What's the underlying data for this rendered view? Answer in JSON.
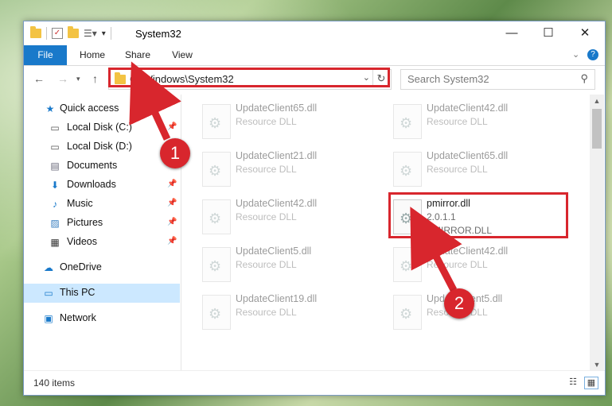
{
  "window": {
    "title": "System32"
  },
  "ribbon": {
    "tabs": [
      "File",
      "Home",
      "Share",
      "View"
    ]
  },
  "address": {
    "path": "C:\\Windows\\System32"
  },
  "search": {
    "placeholder": "Search System32"
  },
  "sidebar": {
    "items": [
      {
        "label": "Quick access",
        "icon": "star-icon",
        "pinned": false
      },
      {
        "label": "Local Disk (C:)",
        "icon": "drive-icon",
        "pinned": true
      },
      {
        "label": "Local Disk (D:)",
        "icon": "drive-icon",
        "pinned": true
      },
      {
        "label": "Documents",
        "icon": "document-icon",
        "pinned": true
      },
      {
        "label": "Downloads",
        "icon": "download-icon",
        "pinned": true
      },
      {
        "label": "Music",
        "icon": "music-icon",
        "pinned": true
      },
      {
        "label": "Pictures",
        "icon": "picture-icon",
        "pinned": true
      },
      {
        "label": "Videos",
        "icon": "video-icon",
        "pinned": true
      },
      {
        "label": "OneDrive",
        "icon": "cloud-icon",
        "pinned": false
      },
      {
        "label": "This PC",
        "icon": "computer-icon",
        "pinned": false
      },
      {
        "label": "Network",
        "icon": "network-icon",
        "pinned": false
      }
    ]
  },
  "files": [
    {
      "name": "UpdateClient65.dll",
      "desc": "Resource DLL"
    },
    {
      "name": "UpdateClient42.dll",
      "desc": "Resource DLL"
    },
    {
      "name": "UpdateClient21.dll",
      "desc": "Resource DLL"
    },
    {
      "name": "UpdateClient65.dll",
      "desc": "Resource DLL"
    },
    {
      "name": "UpdateClient42.dll",
      "desc": "Resource DLL"
    },
    {
      "name": "pmirror.dll",
      "version": "2.0.1.1",
      "desc": "PMIRROR.DLL"
    },
    {
      "name": "UpdateClient5.dll",
      "desc": "Resource DLL"
    },
    {
      "name": "UpdateClient42.dll",
      "desc": "Resource DLL"
    },
    {
      "name": "UpdateClient19.dll",
      "desc": "Resource DLL"
    },
    {
      "name": "UpdateClient5.dll",
      "desc": "Resource DLL"
    }
  ],
  "status": {
    "count": "140 items"
  },
  "callouts": [
    "1",
    "2"
  ],
  "colors": {
    "accent": "#1979ca",
    "highlight": "#d8262d",
    "selected": "#cce8ff"
  }
}
